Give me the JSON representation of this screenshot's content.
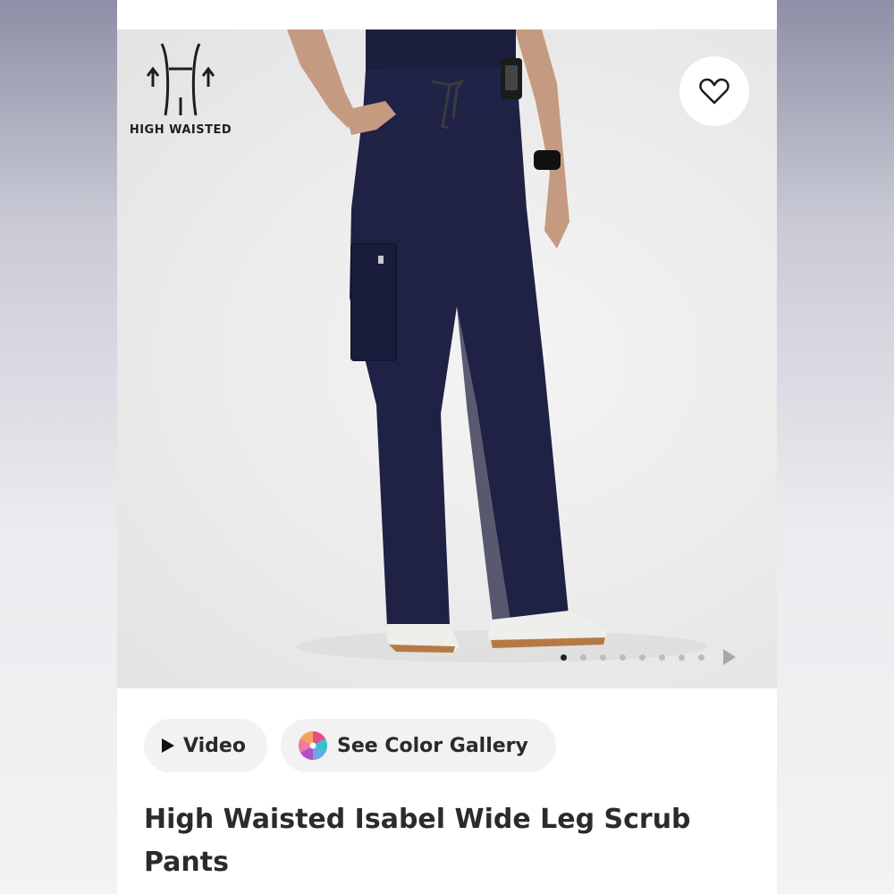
{
  "badge": {
    "label": "HIGH WAISTED",
    "icon": "high-waist-icon"
  },
  "favorite": {
    "icon": "heart-icon"
  },
  "carousel": {
    "dot_count": 8,
    "active_index": 0,
    "next_icon": "chevron-right-icon"
  },
  "actions": {
    "video_label": "Video",
    "video_icon": "play-icon",
    "gallery_label": "See Color Gallery",
    "gallery_icon": "color-wheel-icon"
  },
  "product": {
    "title": "High Waisted Isabel Wide Leg Scrub Pants"
  },
  "colors": {
    "pants": "#1f2145",
    "accent_pink": "#e94b8a",
    "accent_teal": "#38c1c9",
    "pill_bg": "#f2f2f2"
  }
}
